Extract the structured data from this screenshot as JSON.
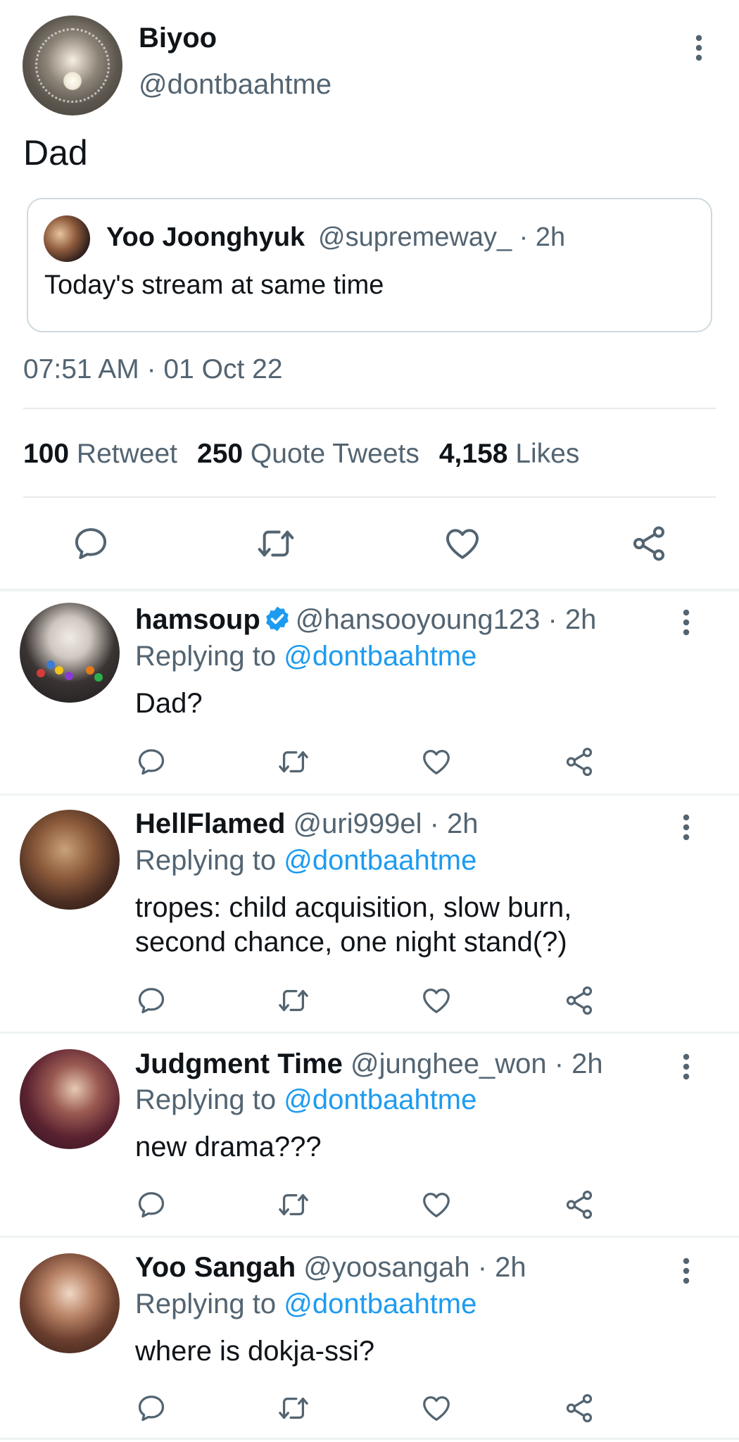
{
  "tweet": {
    "author_name": "Biyoo",
    "author_handle": "@dontbaahtme",
    "text": "Dad",
    "quoted": {
      "author_name": "Yoo Joonghyuk",
      "meta": "@supremeway_ · 2h",
      "text": "Today's stream at same time"
    },
    "timestamp": "07:51 AM · 01 Oct 22",
    "stats": {
      "retweets_count": "100",
      "retweets_label": "Retweet",
      "quotes_count": "250",
      "quotes_label": "Quote Tweets",
      "likes_count": "4,158",
      "likes_label": "Likes"
    },
    "icons": [
      "reply-icon",
      "retweet-icon",
      "like-icon",
      "share-icon"
    ]
  },
  "replies": [
    {
      "name": "hamsoup",
      "verified": true,
      "meta": "@hansooyoung123 · 2h",
      "replying_prefix": "Replying to",
      "replying_to": "@dontbaahtme",
      "text_lines": [
        "Dad?"
      ]
    },
    {
      "name": "HellFlamed",
      "verified": false,
      "meta": "@uri999el · 2h",
      "replying_prefix": "Replying to",
      "replying_to": "@dontbaahtme",
      "text_lines": [
        "tropes: child acquisition, slow burn,",
        "second chance, one night stand(?)"
      ]
    },
    {
      "name": "Judgment Time",
      "verified": false,
      "meta": "@junghee_won · 2h",
      "replying_prefix": "Replying to",
      "replying_to": "@dontbaahtme",
      "text_lines": [
        "new drama???"
      ]
    },
    {
      "name": "Yoo Sangah",
      "verified": false,
      "meta": "@yoosangah · 2h",
      "replying_prefix": "Replying to",
      "replying_to": "@dontbaahtme",
      "text_lines": [
        "where is dokja-ssi?"
      ]
    }
  ],
  "colors": {
    "text": "#0f1419",
    "secondary": "#536471",
    "link": "#1d9bf0",
    "verified": "#1d9bf0",
    "divider": "#e7e9ea"
  }
}
